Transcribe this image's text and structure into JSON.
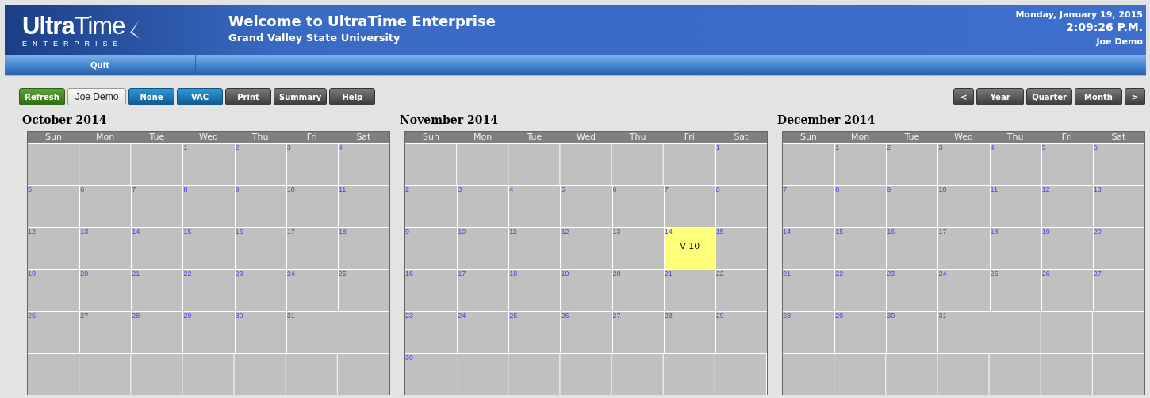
{
  "header": {
    "logo": {
      "name": "**Ultra**Time",
      "subtitle": "ENTERPRISE"
    },
    "title": "Welcome to UltraTime Enterprise",
    "subtitle": "Grand Valley State University",
    "date": "Monday, January 19, 2015",
    "time": "2:09:26 P.M.",
    "user": "Joe Demo"
  },
  "menu": [
    {
      "label": "Quit"
    }
  ],
  "toolbar": [
    {
      "label": "Refresh",
      "kind": "green"
    },
    {
      "label": "Joe Demo",
      "kind": "plain"
    },
    {
      "label": "None",
      "kind": "blue"
    },
    {
      "label": "VAC",
      "kind": "blue"
    },
    {
      "label": "Print",
      "kind": "dark"
    },
    {
      "label": "Summary",
      "kind": "dark"
    },
    {
      "label": "Help",
      "kind": "dark"
    }
  ],
  "view_buttons": [
    "<",
    "Year",
    "Quarter",
    "Month",
    ">"
  ],
  "months": [
    {
      "title": "October 2014",
      "weekdays": [
        "Sun",
        "Mon",
        "Tue",
        "Wed",
        "Thu",
        "Fri",
        "Sat"
      ],
      "weeks": [
        {
          "kind": "first",
          "days": [
            {
              "day": "1"
            },
            {
              "day": "2"
            },
            {
              "day": "3"
            },
            {
              "day": "4"
            }
          ]
        },
        {
          "kind": "full",
          "days": [
            {
              "day": "5"
            },
            {
              "day": "6"
            },
            {
              "day": "7"
            },
            {
              "day": "8"
            },
            {
              "day": "9"
            },
            {
              "day": "10"
            },
            {
              "day": "11"
            }
          ]
        },
        {
          "kind": "full",
          "days": [
            {
              "day": "12"
            },
            {
              "day": "13"
            },
            {
              "day": "14"
            },
            {
              "day": "15"
            },
            {
              "day": "16"
            },
            {
              "day": "17"
            },
            {
              "day": "18"
            }
          ]
        },
        {
          "kind": "full",
          "days": [
            {
              "day": "19"
            },
            {
              "day": "20"
            },
            {
              "day": "21"
            },
            {
              "day": "22"
            },
            {
              "day": "23"
            },
            {
              "day": "24"
            },
            {
              "day": "25"
            }
          ]
        },
        {
          "kind": "last",
          "days": [
            {
              "day": "26"
            },
            {
              "day": "27"
            },
            {
              "day": "28"
            },
            {
              "day": "29"
            },
            {
              "day": "30"
            },
            {
              "day": "31"
            }
          ]
        },
        {
          "kind": "blank"
        }
      ]
    },
    {
      "title": "November 2014",
      "weekdays": [
        "Sun",
        "Mon",
        "Tue",
        "Wed",
        "Thu",
        "Fri",
        "Sat"
      ],
      "weeks": [
        {
          "kind": "first",
          "days": [
            {
              "day": "1"
            }
          ]
        },
        {
          "kind": "full",
          "days": [
            {
              "day": "2"
            },
            {
              "day": "3"
            },
            {
              "day": "4"
            },
            {
              "day": "5"
            },
            {
              "day": "6"
            },
            {
              "day": "7"
            },
            {
              "day": "8"
            }
          ]
        },
        {
          "kind": "full",
          "days": [
            {
              "day": "9"
            },
            {
              "day": "10"
            },
            {
              "day": "11"
            },
            {
              "day": "12"
            },
            {
              "day": "13"
            },
            {
              "day": "14",
              "entry": "V 10",
              "color": "#ffff77"
            },
            {
              "day": "15"
            }
          ]
        },
        {
          "kind": "full",
          "days": [
            {
              "day": "16"
            },
            {
              "day": "17"
            },
            {
              "day": "18"
            },
            {
              "day": "19"
            },
            {
              "day": "20"
            },
            {
              "day": "21"
            },
            {
              "day": "22"
            }
          ]
        },
        {
          "kind": "full",
          "days": [
            {
              "day": "23"
            },
            {
              "day": "24"
            },
            {
              "day": "25"
            },
            {
              "day": "26"
            },
            {
              "day": "27"
            },
            {
              "day": "28"
            },
            {
              "day": "29"
            }
          ]
        },
        {
          "kind": "last",
          "days": [
            {
              "day": "30"
            }
          ]
        }
      ]
    },
    {
      "title": "December 2014",
      "weekdays": [
        "Sun",
        "Mon",
        "Tue",
        "Wed",
        "Thu",
        "Fri",
        "Sat"
      ],
      "weeks": [
        {
          "kind": "first",
          "days": [
            {
              "day": "1"
            },
            {
              "day": "2"
            },
            {
              "day": "3"
            },
            {
              "day": "4"
            },
            {
              "day": "5"
            },
            {
              "day": "6"
            }
          ]
        },
        {
          "kind": "full",
          "days": [
            {
              "day": "7"
            },
            {
              "day": "8"
            },
            {
              "day": "9"
            },
            {
              "day": "10"
            },
            {
              "day": "11"
            },
            {
              "day": "12"
            },
            {
              "day": "13"
            }
          ]
        },
        {
          "kind": "full",
          "days": [
            {
              "day": "14"
            },
            {
              "day": "15"
            },
            {
              "day": "16"
            },
            {
              "day": "17"
            },
            {
              "day": "18"
            },
            {
              "day": "19"
            },
            {
              "day": "20"
            }
          ]
        },
        {
          "kind": "full",
          "days": [
            {
              "day": "21"
            },
            {
              "day": "22"
            },
            {
              "day": "23"
            },
            {
              "day": "24"
            },
            {
              "day": "25"
            },
            {
              "day": "26"
            },
            {
              "day": "27"
            }
          ]
        },
        {
          "kind": "last",
          "days": [
            {
              "day": "28"
            },
            {
              "day": "29"
            },
            {
              "day": "30"
            },
            {
              "day": "31"
            }
          ]
        },
        {
          "kind": "blank"
        }
      ]
    }
  ]
}
